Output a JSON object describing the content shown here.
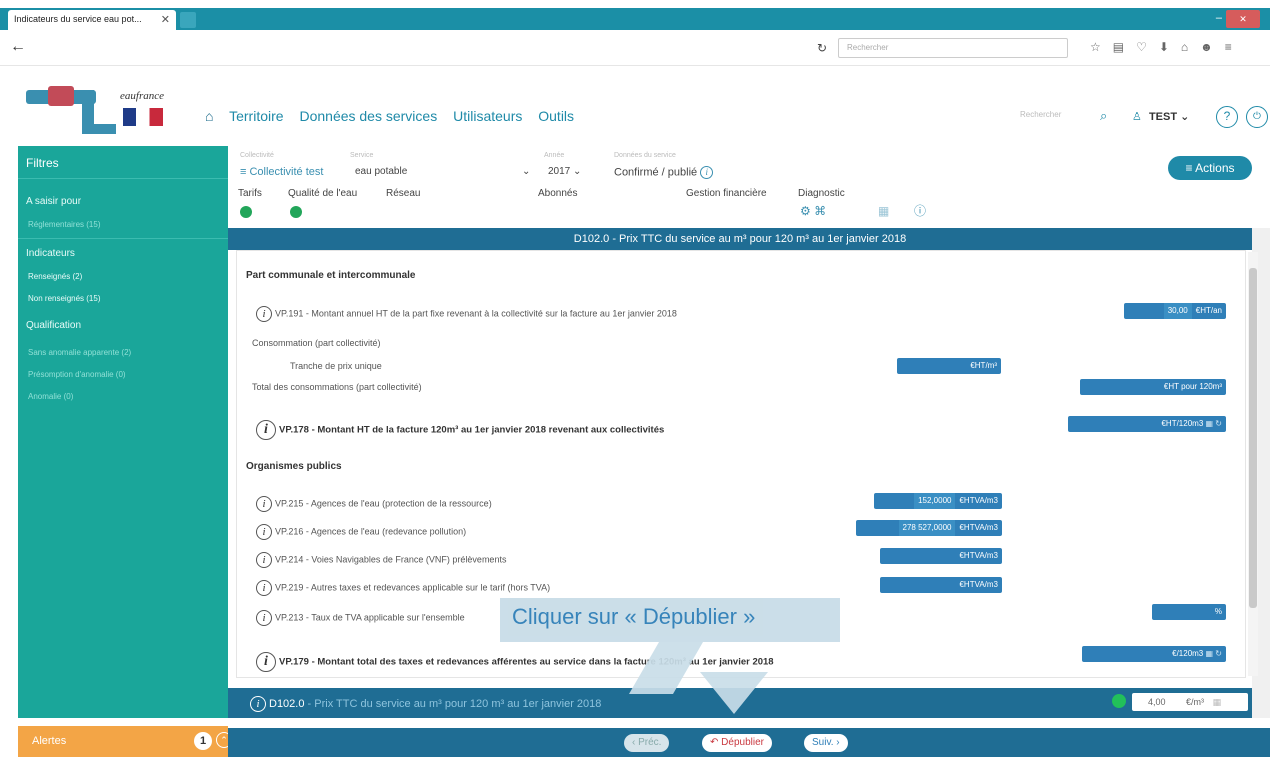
{
  "browser": {
    "tab_title": "Indicateurs du service eau pot...",
    "tab_close": "✕",
    "search_placeholder": "Rechercher"
  },
  "header": {
    "brand": "eaufrance",
    "nav": [
      "Territoire",
      "Données des services",
      "Utilisateurs",
      "Outils"
    ],
    "search_placeholder": "Rechercher",
    "user": "TEST",
    "help": "?"
  },
  "sidebar": {
    "title": "Filtres",
    "a_saisir": "A saisir pour",
    "a_saisir_sub": "Réglementaires (15)",
    "indicateurs": "Indicateurs",
    "renseignes": "Renseignés (2)",
    "non_renseignes": "Non renseignés (15)",
    "qualification": "Qualification",
    "q1": "Sans anomalie apparente (2)",
    "q2": "Présomption d'anomalie (0)",
    "q3": "Anomalie (0)",
    "alertes": "Alertes",
    "alertes_count": "1"
  },
  "context": {
    "collectivite_label": "Collectivité",
    "collectivite": "Collectivité test",
    "service_label": "Service",
    "service": "eau potable",
    "annee_label": "Année",
    "annee": "2017",
    "etat_label": "Données du service",
    "etat": "Confirmé / publié",
    "actions": "Actions",
    "tabs": [
      "Tarifs",
      "Qualité de l'eau",
      "Réseau",
      "Abonnés",
      "Gestion financière",
      "Diagnostic"
    ]
  },
  "indicator_title": "D102.0 - Prix TTC du service au m³ pour 120 m³ au 1er janvier 2018",
  "sections": {
    "part_communale": "Part communale et intercommunale",
    "organismes": "Organismes publics"
  },
  "rows": {
    "vp191": "VP.191 - Montant annuel HT de la part fixe revenant à la collectivité sur la facture au 1er janvier 2018",
    "vp191_value": "30,00",
    "vp191_unit": "€HT/an",
    "conso": "Consommation (part collectivité)",
    "tranche": "Tranche de prix unique",
    "tranche_unit": "€HT/m³",
    "total_conso": "Total des consommations (part collectivité)",
    "total_conso_unit": "€HT pour 120m³",
    "vp178": "VP.178 - Montant HT de la facture 120m³ au 1er janvier 2018 revenant aux collectivités",
    "vp178_unit": "€HT/120m3",
    "vp215": "VP.215 - Agences de l'eau (protection de la ressource)",
    "vp215_value": "152,0000",
    "vp215_unit": "€HTVA/m3",
    "vp216": "VP.216 - Agences de l'eau (redevance pollution)",
    "vp216_value": "278 527,0000",
    "vp216_unit": "€HTVA/m3",
    "vp214": "VP.214 - Voies Navigables de France (VNF) prélèvements",
    "vp214_unit": "€HTVA/m3",
    "vp219": "VP.219 - Autres taxes et redevances applicable sur le tarif (hors TVA)",
    "vp219_unit": "€HTVA/m3",
    "vp213": "VP.213 - Taux de TVA applicable sur l'ensemble",
    "vp213_unit": "%",
    "vp179": "VP.179 - Montant total des taxes et redevances afférentes au service dans la facture 120m³ au 1er janvier 2018",
    "vp179_unit": "€/120m3"
  },
  "footer": {
    "code": "D102.0",
    "label": " - Prix TTC du service au m³ pour 120 m³ au 1er janvier 2018",
    "value": "4,00",
    "unit": "€/m³"
  },
  "buttons": {
    "prev": "Préc.",
    "depublier": "Dépublier",
    "next": "Suiv."
  },
  "callout": "Cliquer sur « Dépublier »"
}
